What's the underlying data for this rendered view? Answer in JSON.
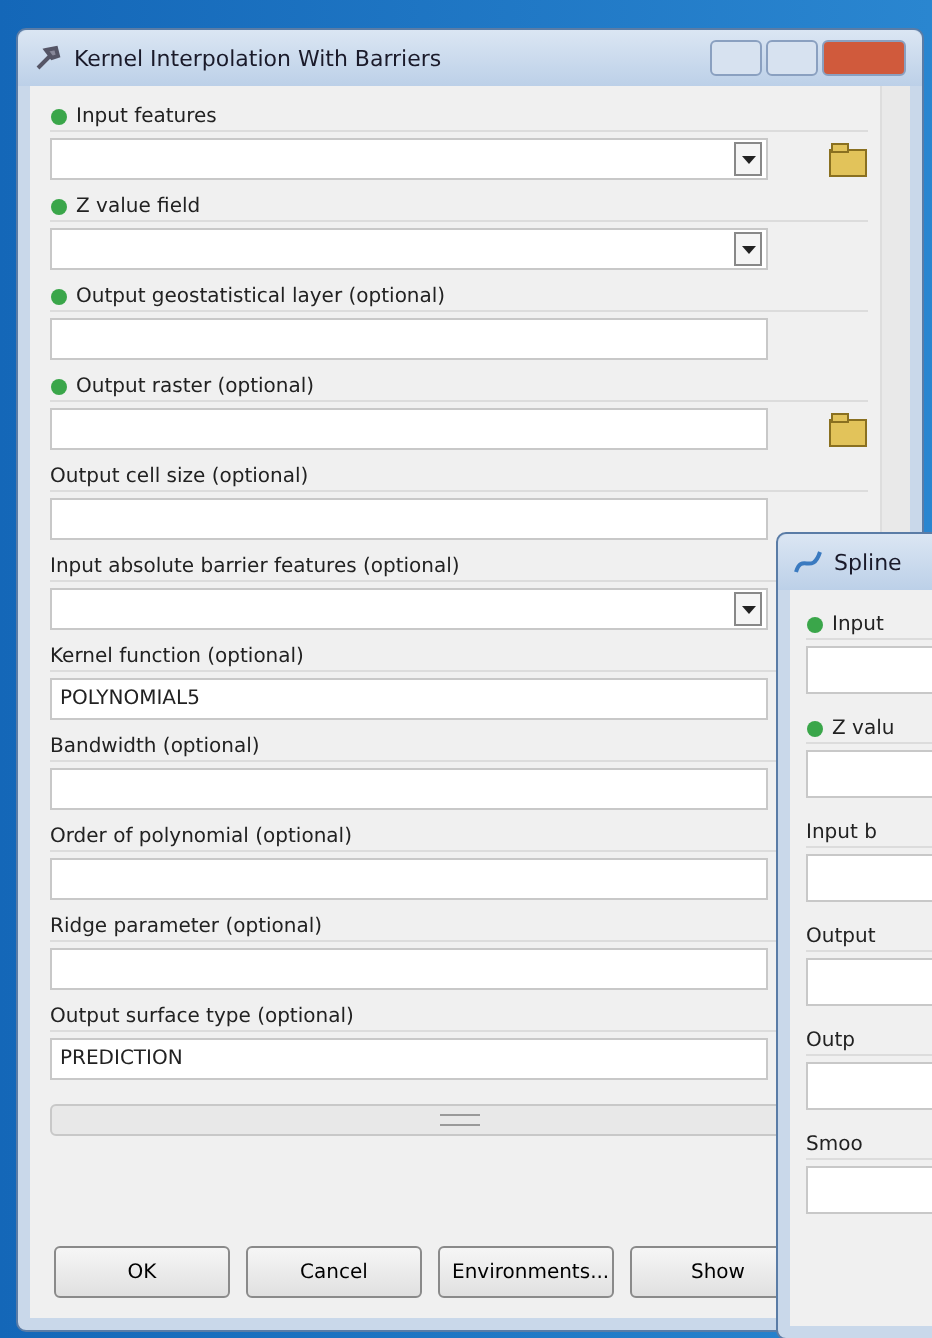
{
  "main_window": {
    "title": "Kernel Interpolation With Barriers",
    "parameters": [
      {
        "label": "Input features",
        "marker": true,
        "kind": "combo",
        "browse": true
      },
      {
        "label": "Z value field",
        "marker": true,
        "kind": "combo",
        "browse": false
      },
      {
        "label": "Output geostatistical layer (optional)",
        "marker": true,
        "kind": "text",
        "browse": false
      },
      {
        "label": "Output raster (optional)",
        "marker": true,
        "kind": "text",
        "browse": true
      },
      {
        "label": "Output cell size (optional)",
        "marker": false,
        "kind": "text",
        "browse": false
      },
      {
        "label": "Input absolute barrier features (optional)",
        "marker": false,
        "kind": "combo",
        "browse": false
      },
      {
        "label": "Kernel function (optional)",
        "marker": false,
        "kind": "value",
        "value": "POLYNOMIAL5",
        "browse": false
      },
      {
        "label": "Bandwidth (optional)",
        "marker": false,
        "kind": "text",
        "browse": false
      },
      {
        "label": "Order of polynomial (optional)",
        "marker": false,
        "kind": "text",
        "browse": false
      },
      {
        "label": "Ridge parameter (optional)",
        "marker": false,
        "kind": "text",
        "browse": false
      },
      {
        "label": "Output surface type (optional)",
        "marker": false,
        "kind": "value",
        "value": "PREDICTION",
        "browse": false
      }
    ],
    "buttons": [
      "OK",
      "Cancel",
      "Environments...",
      "Show"
    ]
  },
  "second_window": {
    "title": "Spline",
    "parameters": [
      {
        "label": "Input",
        "marker": true
      },
      {
        "label": "Z valu",
        "marker": true
      },
      {
        "label": "Input b",
        "marker": false
      },
      {
        "label": "Output",
        "marker": false
      },
      {
        "label": "Outp",
        "marker": false
      },
      {
        "label": "Smoo",
        "marker": false
      }
    ]
  }
}
